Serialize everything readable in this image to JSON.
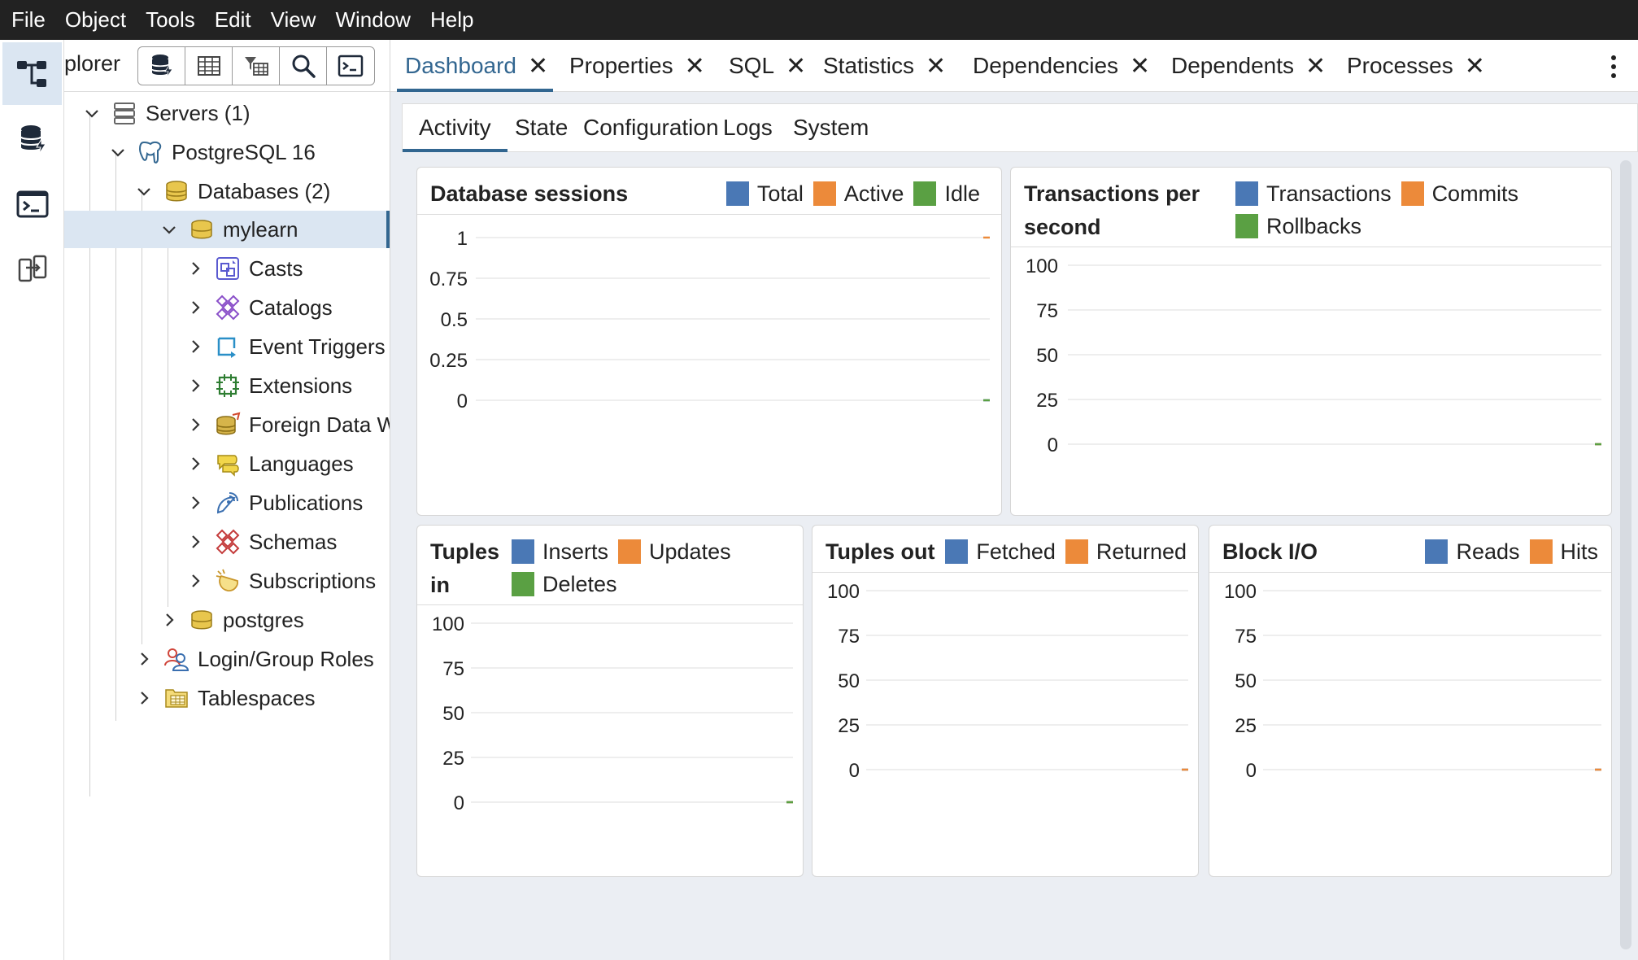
{
  "menu": [
    "File",
    "Object",
    "Tools",
    "Edit",
    "View",
    "Window",
    "Help"
  ],
  "explorer": {
    "title": "plorer",
    "tree": {
      "servers": "Servers (1)",
      "postgres16": "PostgreSQL 16",
      "databases": "Databases (2)",
      "mylearn": "mylearn",
      "casts": "Casts",
      "catalogs": "Catalogs",
      "event_triggers": "Event Triggers",
      "extensions": "Extensions",
      "fdw": "Foreign Data W",
      "languages": "Languages",
      "publications": "Publications",
      "schemas": "Schemas",
      "subscriptions": "Subscriptions",
      "postgres": "postgres",
      "login_roles": "Login/Group Roles",
      "tablespaces": "Tablespaces"
    }
  },
  "tabs": [
    "Dashboard",
    "Properties",
    "SQL",
    "Statistics",
    "Dependencies",
    "Dependents",
    "Processes"
  ],
  "close_glyph": "✕",
  "subtabs": [
    "Activity",
    "State",
    "Configuration",
    "Logs",
    "System"
  ],
  "colors": {
    "blue": "#4a78b5",
    "orange": "#ec8a3a",
    "green": "#5aa043",
    "accent": "#326690"
  },
  "chart_data": [
    {
      "type": "line",
      "title": "Database sessions",
      "series": [
        {
          "name": "Total",
          "values": [
            0
          ]
        },
        {
          "name": "Active",
          "values": [
            1
          ]
        },
        {
          "name": "Idle",
          "values": [
            0
          ]
        }
      ],
      "ylim": [
        0,
        1
      ],
      "yticks": [
        "1",
        "0.75",
        "0.5",
        "0.25",
        "0"
      ],
      "grid": true,
      "legend": "top-right"
    },
    {
      "type": "line",
      "title": "Transactions per second",
      "series": [
        {
          "name": "Transactions",
          "values": [
            0
          ]
        },
        {
          "name": "Commits",
          "values": [
            0
          ]
        },
        {
          "name": "Rollbacks",
          "values": [
            0
          ]
        }
      ],
      "ylim": [
        0,
        100
      ],
      "yticks": [
        "100",
        "75",
        "50",
        "25",
        "0"
      ],
      "grid": true,
      "legend": "top-right"
    },
    {
      "type": "line",
      "title": "Tuples in",
      "series": [
        {
          "name": "Inserts",
          "values": [
            0
          ]
        },
        {
          "name": "Updates",
          "values": [
            0
          ]
        },
        {
          "name": "Deletes",
          "values": [
            0
          ]
        }
      ],
      "ylim": [
        0,
        100
      ],
      "yticks": [
        "100",
        "75",
        "50",
        "25",
        "0"
      ],
      "grid": true,
      "legend": "top-right"
    },
    {
      "type": "line",
      "title": "Tuples out",
      "series": [
        {
          "name": "Fetched",
          "values": [
            0
          ]
        },
        {
          "name": "Returned",
          "values": [
            0
          ]
        }
      ],
      "ylim": [
        0,
        100
      ],
      "yticks": [
        "100",
        "75",
        "50",
        "25",
        "0"
      ],
      "grid": true,
      "legend": "top-right"
    },
    {
      "type": "line",
      "title": "Block I/O",
      "series": [
        {
          "name": "Reads",
          "values": [
            0
          ]
        },
        {
          "name": "Hits",
          "values": [
            0
          ]
        }
      ],
      "ylim": [
        0,
        100
      ],
      "yticks": [
        "100",
        "75",
        "50",
        "25",
        "0"
      ],
      "grid": true,
      "legend": "top-right"
    }
  ]
}
